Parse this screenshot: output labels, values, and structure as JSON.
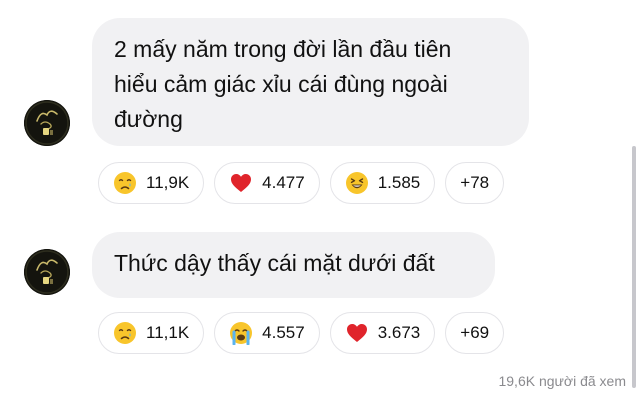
{
  "messages": [
    {
      "lines": [
        "2 mấy năm trong đời lần đầu tiên",
        "hiểu cảm giác xỉu cái đùng ngoài",
        "đường"
      ],
      "reactions": [
        {
          "icon": "crying-face-icon",
          "count": "11,9K"
        },
        {
          "icon": "red-heart-icon",
          "count": "4.477"
        },
        {
          "icon": "laughing-squint-face-icon",
          "count": "1.585"
        },
        {
          "icon": "",
          "count": "+78"
        }
      ]
    },
    {
      "lines": [
        "Thức dậy thấy cái mặt dưới đất"
      ],
      "reactions": [
        {
          "icon": "crying-face-icon",
          "count": "11,1K"
        },
        {
          "icon": "loudly-crying-face-icon",
          "count": "4.557"
        },
        {
          "icon": "red-heart-icon",
          "count": "3.673"
        },
        {
          "icon": "",
          "count": "+69"
        }
      ]
    }
  ],
  "seen_text": "19,6K người đã xem",
  "colors": {
    "bubble": "#f1f1f3",
    "chip_border": "#e4e4e8",
    "muted_text": "#8a8a8e",
    "heart": "#e0242b",
    "emoji_yellow": "#f8c52b"
  }
}
